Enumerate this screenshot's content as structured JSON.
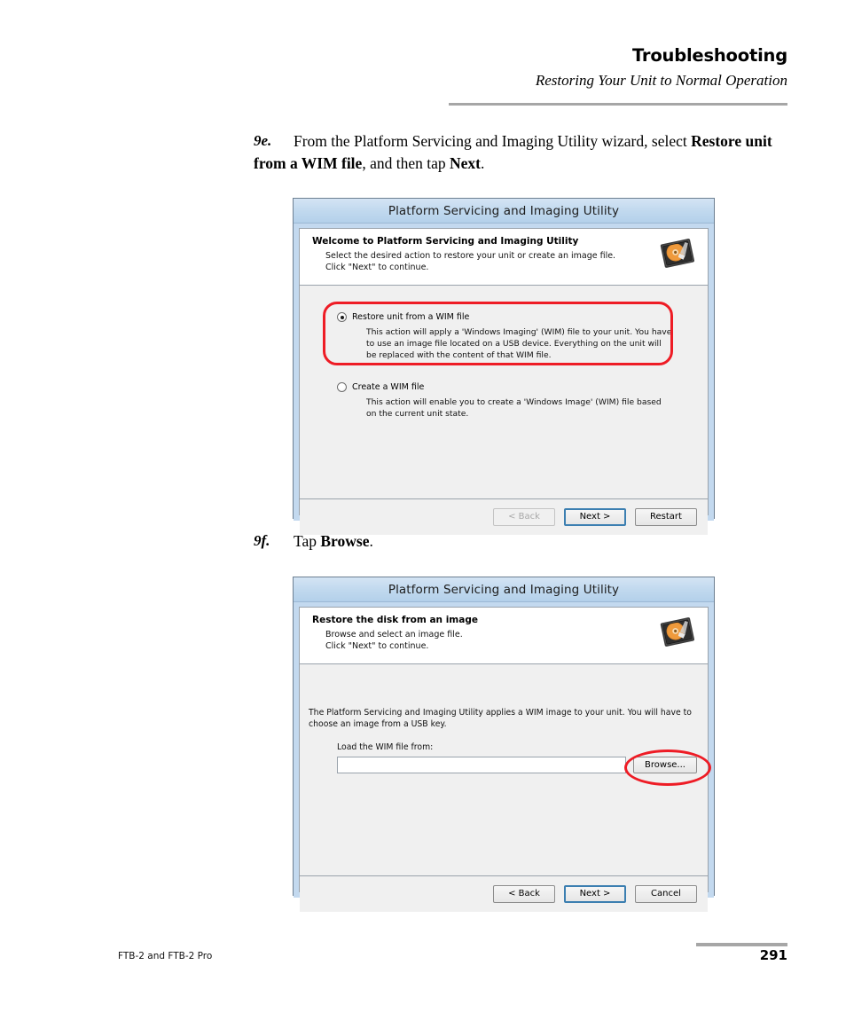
{
  "page": {
    "header": {
      "chapter": "Troubleshooting",
      "section": "Restoring Your Unit to Normal Operation"
    },
    "footer": {
      "product": "FTB-2 and FTB-2 Pro",
      "page_number": "291"
    },
    "accent_red": "#ee1c25",
    "rule_gray": "#a6a6a6"
  },
  "steps": [
    {
      "number": "9e.",
      "text_parts": [
        {
          "text": "From the Platform Servicing and Imaging Utility wizard, select ",
          "bold": false
        },
        {
          "text": "Restore unit from a WIM file",
          "bold": true
        },
        {
          "text": ", and then tap ",
          "bold": false
        },
        {
          "text": "Next",
          "bold": true
        },
        {
          "text": ".",
          "bold": false
        }
      ]
    },
    {
      "number": "9f.",
      "text_parts": [
        {
          "text": "Tap ",
          "bold": false
        },
        {
          "text": "Browse",
          "bold": true
        },
        {
          "text": ".",
          "bold": false
        }
      ]
    }
  ],
  "dialog1": {
    "title": "Platform Servicing and Imaging Utility",
    "banner": {
      "title": "Welcome to Platform Servicing and Imaging Utility",
      "line1": "Select the desired action to restore your unit or create an image file.",
      "line2": "Click \"Next\" to continue."
    },
    "icon_name": "hard-disk-drive-icon",
    "options": [
      {
        "label": "Restore unit from a WIM file",
        "selected": true,
        "description": "This action will apply a 'Windows Imaging' (WIM) file to your unit. You have to use an image file located on a USB device. Everything on the unit will be replaced with the content of that WIM file.",
        "highlighted": true
      },
      {
        "label": "Create a WIM file",
        "selected": false,
        "description": "This action will enable you to create a 'Windows Image' (WIM) file based on the current unit state.",
        "highlighted": false
      }
    ],
    "buttons": [
      {
        "label": "< Back",
        "state": "disabled"
      },
      {
        "label": "Next >",
        "state": "default"
      },
      {
        "label": "Restart",
        "state": "normal"
      }
    ]
  },
  "dialog2": {
    "title": "Platform Servicing and Imaging Utility",
    "banner": {
      "title": "Restore the disk from an image",
      "line1": "Browse and select an image file.",
      "line2": "Click \"Next\" to continue."
    },
    "icon_name": "hard-disk-drive-icon",
    "paragraph": "The Platform Servicing and Imaging Utility applies a WIM image to your unit. You will have to choose an image from a USB key.",
    "field_label": "Load the WIM file from:",
    "field_value": "",
    "field_placeholder": "",
    "browse_label": "Browse...",
    "buttons": [
      {
        "label": "< Back",
        "state": "normal"
      },
      {
        "label": "Next >",
        "state": "default"
      },
      {
        "label": "Cancel",
        "state": "normal"
      }
    ]
  }
}
